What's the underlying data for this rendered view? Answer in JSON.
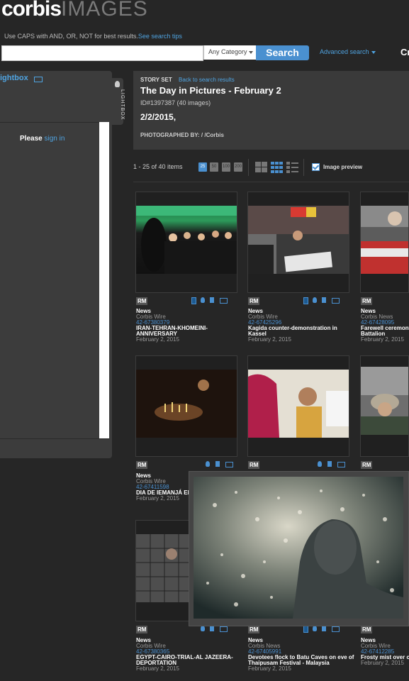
{
  "brand": {
    "logo_bold": "corbis",
    "logo_light": "IMAGES"
  },
  "search": {
    "hint": "Use CAPS with AND, OR, NOT for best results.",
    "hint_link": "See search tips",
    "input_value": "",
    "category": "Any Category",
    "button": "Search",
    "advanced": "Advanced search",
    "right_cut": "Cr"
  },
  "lightbox": {
    "title": "ightbox",
    "tab_label": "LIGHTBOX",
    "signin_prefix": "Please",
    "signin_link": "sign in"
  },
  "story": {
    "set_label": "STORY SET",
    "back_link": "Back to search results",
    "title": "The Day in Pictures - February 2",
    "id_line": "ID#1397387 (40 images)",
    "date": "2/2/2015,",
    "photographed_by": "PHOTOGRAPHED BY:  / /Corbis"
  },
  "results": {
    "range": "1 - 25 of 40 items",
    "page_sizes": [
      "25",
      "50",
      "100",
      "200"
    ],
    "preview_label": "Image preview",
    "preview_checked": true
  },
  "tiles": [
    {
      "license": "RM",
      "category": "News",
      "source": "Corbis Wire",
      "id": "42-67380379",
      "caption": "IRAN-TEHRAN-KHOMEINI-ANNIVERSARY",
      "date": "February 2, 2015"
    },
    {
      "license": "RM",
      "category": "News",
      "source": "Corbis Wire",
      "id": "42-67425296",
      "caption": "Kagida counter-demonstration in Kassel",
      "date": "February 2, 2015"
    },
    {
      "license": "RM",
      "category": "News",
      "source": "Corbis News",
      "id": "42-67428095",
      "caption": "Farewell ceremony Aidar Battalion",
      "date": "February 2, 2015"
    },
    {
      "license": "RM",
      "category": "News",
      "source": "Corbis Wire",
      "id": "42-67411598",
      "caption": "DIA DE IEMANJÁ EM",
      "date": "February 2, 2015"
    },
    {
      "license": "RM",
      "category": "",
      "source": "",
      "id": "",
      "caption": "",
      "date": ""
    },
    {
      "license": "RM",
      "category": "",
      "source": "",
      "id": "",
      "caption": "",
      "date": ""
    },
    {
      "license": "RM",
      "category": "News",
      "source": "Corbis Wire",
      "id": "42-67380365",
      "caption": "EGYPT-CAIRO-TRIAL-AL JAZEERA-DEPORTATION",
      "date": "February 2, 2015"
    },
    {
      "license": "RM",
      "category": "News",
      "source": "Corbis News",
      "id": "42-67405991",
      "caption": "Devotees flock to Batu Caves on eve of Thaipusam Festival - Malaysia",
      "date": "February 2, 2015"
    },
    {
      "license": "RM",
      "category": "News",
      "source": "Corbis Wire",
      "id": "42-67412285",
      "caption": "Frosty mist over c",
      "date": "February 2, 2015"
    }
  ]
}
